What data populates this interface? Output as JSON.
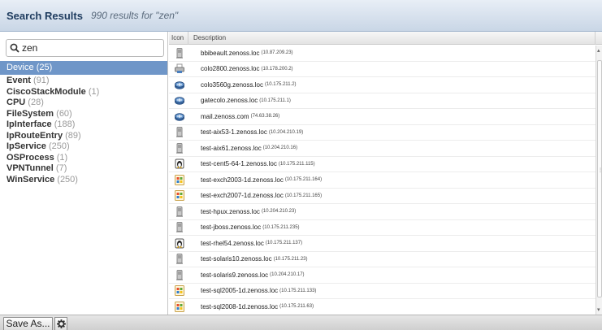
{
  "header": {
    "title": "Search Results",
    "subtitle": "990 results for \"zen\""
  },
  "search": {
    "value": "zen",
    "icon": "search-icon"
  },
  "categories": [
    {
      "name": "Device",
      "count": "(25)",
      "selected": true
    },
    {
      "name": "Event",
      "count": "(91)"
    },
    {
      "name": "CiscoStackModule",
      "count": "(1)"
    },
    {
      "name": "CPU",
      "count": "(28)"
    },
    {
      "name": "FileSystem",
      "count": "(60)"
    },
    {
      "name": "IpInterface",
      "count": "(188)"
    },
    {
      "name": "IpRouteEntry",
      "count": "(89)"
    },
    {
      "name": "IpService",
      "count": "(250)"
    },
    {
      "name": "OSProcess",
      "count": "(1)"
    },
    {
      "name": "VPNTunnel",
      "count": "(7)"
    },
    {
      "name": "WinService",
      "count": "(250)"
    }
  ],
  "grid": {
    "columns": {
      "icon": "Icon",
      "description": "Description"
    },
    "rows": [
      {
        "icon": "server-icon",
        "name": "bbibeault.zenoss.loc",
        "ip": "(10.87.209.23)"
      },
      {
        "icon": "printer-icon",
        "name": "colo2800.zenoss.loc",
        "ip": "(10.178.200.2)"
      },
      {
        "icon": "router-icon",
        "name": "colo3560g.zenoss.loc",
        "ip": "(10.175.211.2)"
      },
      {
        "icon": "router-icon",
        "name": "gatecolo.zenoss.loc",
        "ip": "(10.175.211.1)"
      },
      {
        "icon": "router-icon",
        "name": "mail.zenoss.com",
        "ip": "(74.63.38.26)"
      },
      {
        "icon": "server-icon",
        "name": "test-aix53-1.zenoss.loc",
        "ip": "(10.204.210.19)"
      },
      {
        "icon": "server-icon",
        "name": "test-aix61.zenoss.loc",
        "ip": "(10.204.210.16)"
      },
      {
        "icon": "linux-icon",
        "name": "test-cent5-64-1.zenoss.loc",
        "ip": "(10.175.211.115)"
      },
      {
        "icon": "windows-icon",
        "name": "test-exch2003-1d.zenoss.loc",
        "ip": "(10.175.211.164)"
      },
      {
        "icon": "windows-icon",
        "name": "test-exch2007-1d.zenoss.loc",
        "ip": "(10.175.211.165)"
      },
      {
        "icon": "server-icon",
        "name": "test-hpux.zenoss.loc",
        "ip": "(10.204.210.23)"
      },
      {
        "icon": "server-icon",
        "name": "test-jboss.zenoss.loc",
        "ip": "(10.175.211.235)"
      },
      {
        "icon": "linux-icon",
        "name": "test-rhel54.zenoss.loc",
        "ip": "(10.175.211.137)"
      },
      {
        "icon": "server-icon",
        "name": "test-solaris10.zenoss.loc",
        "ip": "(10.175.211.23)"
      },
      {
        "icon": "server-icon",
        "name": "test-solaris9.zenoss.loc",
        "ip": "(10.204.210.17)"
      },
      {
        "icon": "windows-icon",
        "name": "test-sql2005-1d.zenoss.loc",
        "ip": "(10.175.211.133)"
      },
      {
        "icon": "windows-icon",
        "name": "test-sql2008-1d.zenoss.loc",
        "ip": "(10.175.211.63)"
      }
    ]
  },
  "footer": {
    "save_label": "Save As...",
    "gear_icon": "gear-icon"
  }
}
